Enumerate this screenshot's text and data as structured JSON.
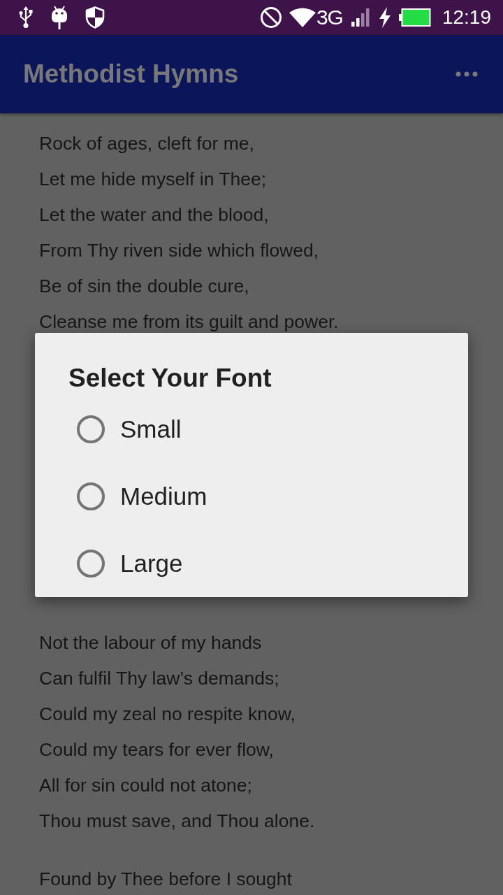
{
  "status_bar": {
    "network": "3G",
    "time": "12:19"
  },
  "app_bar": {
    "title": "Methodist Hymns"
  },
  "hymn": {
    "stanzas": [
      {
        "lines": [
          "Rock of ages, cleft for me,",
          "Let me hide myself in Thee;",
          "Let the water and the blood,",
          "From Thy riven side which flowed,",
          "Be of sin the double cure,",
          "Cleanse me from its guilt and power."
        ]
      },
      {
        "lines": [
          "Not the labour of my hands",
          "Can fulfil Thy law’s demands;",
          "Could my zeal no respite know,",
          "Could my tears for ever flow,",
          "All for sin could not atone;",
          "Thou must save, and Thou alone."
        ]
      },
      {
        "lines": [
          "Found by Thee before I sought"
        ]
      }
    ]
  },
  "dialog": {
    "title": "Select Your Font",
    "options": [
      {
        "label": "Small",
        "selected": false
      },
      {
        "label": "Medium",
        "selected": false
      },
      {
        "label": "Large",
        "selected": false
      }
    ]
  }
}
